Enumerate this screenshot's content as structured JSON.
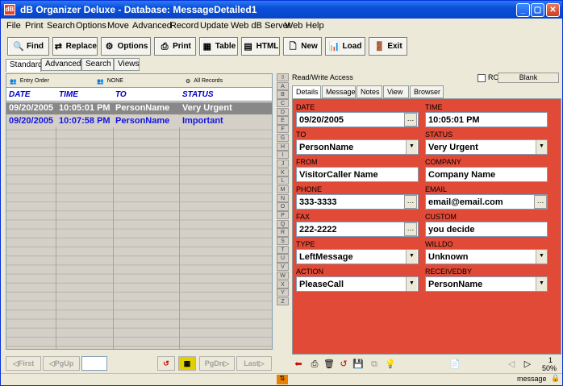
{
  "window": {
    "title": "dB Organizer Deluxe - Database: MessageDetailed1",
    "min": "_",
    "max": "▢",
    "close": "✕"
  },
  "menu": [
    "File",
    "Print",
    "Search",
    "Options",
    "Move",
    "Advanced",
    "Record",
    "Update",
    "Web dB Server",
    "Web",
    "Help"
  ],
  "toolbar": {
    "find": "Find",
    "replace": "Replace",
    "options": "Options",
    "print": "Print",
    "table": "Table",
    "html": "HTML",
    "new": "New",
    "load": "Load",
    "exit": "Exit"
  },
  "view_tabs": [
    "Standard",
    "Advanced",
    "Search",
    "Views"
  ],
  "sort": {
    "order": "Entry Order",
    "none": "NONE",
    "records": "All Records"
  },
  "grid": {
    "headers": [
      "DATE",
      "TIME",
      "TO",
      "STATUS"
    ],
    "rows": [
      {
        "date": "09/20/2005",
        "time": "10:05:01 PM",
        "to": "PersonName",
        "status": "Very Urgent"
      },
      {
        "date": "09/20/2005",
        "time": "10:07:58 PM",
        "to": "PersonName",
        "status": "Important"
      }
    ]
  },
  "nav": {
    "first": "First",
    "pgup": "PgUp",
    "pgdn": "PgDn",
    "last": "Last"
  },
  "alpha": [
    "A",
    "B",
    "C",
    "D",
    "E",
    "F",
    "G",
    "H",
    "I",
    "J",
    "K",
    "L",
    "M",
    "N",
    "O",
    "P",
    "Q",
    "R",
    "S",
    "T",
    "U",
    "V",
    "W",
    "X",
    "Y",
    "Z"
  ],
  "detail": {
    "access": "Read/Write Access",
    "ro": "RO",
    "blank": "Blank",
    "tabs": [
      "Details",
      "Message",
      "Notes",
      "View",
      "Browser"
    ],
    "fields": {
      "date_label": "DATE",
      "date": "09/20/2005",
      "time_label": "TIME",
      "time": "10:05:01 PM",
      "to_label": "TO",
      "to": "PersonName",
      "status_label": "STATUS",
      "status": "Very Urgent",
      "from_label": "FROM",
      "from": "VisitorCaller Name",
      "company_label": "COMPANY",
      "company": "Company Name",
      "phone_label": "PHONE",
      "phone": "333-3333",
      "email_label": "EMAIL",
      "email": "email@email.com",
      "fax_label": "FAX",
      "fax": "222-2222",
      "custom_label": "CUSTOM",
      "custom": "you decide",
      "type_label": "TYPE",
      "type": "LeftMessage",
      "willdo_label": "WILLDO",
      "willdo": "Unknown",
      "action_label": "ACTION",
      "action": "PleaseCall",
      "receivedby_label": "RECEIVEDBY",
      "receivedby": "PersonName"
    }
  },
  "status": {
    "record": "1",
    "zoom": "50%",
    "table": "message"
  },
  "colors": {
    "form_bg": "#e04a36",
    "title_blue": "#0a4fd8",
    "selected_row": "#888888",
    "row_blue": "#1515e0"
  }
}
